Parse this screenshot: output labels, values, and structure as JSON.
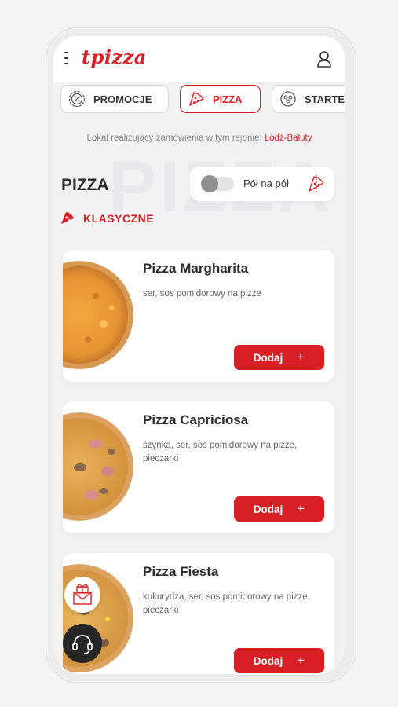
{
  "app": {
    "logo": "tpizza"
  },
  "tabs": [
    {
      "label": "PROMOCJE",
      "icon": "percent-badge-icon",
      "active": false
    },
    {
      "label": "PIZZA",
      "icon": "pizza-slice-icon",
      "active": true
    },
    {
      "label": "STARTE",
      "icon": "starter-icon",
      "active": false
    }
  ],
  "location": {
    "text": "Lokal realizujący zamówienia w tym rejonie:",
    "city": "Łódź-Bałuty"
  },
  "page": {
    "watermark": "PIZZA",
    "title": "PIZZA",
    "half_half_label": "Pół na pół",
    "half_half_enabled": false,
    "section": "KLASYCZNE"
  },
  "products": [
    {
      "name": "Pizza Margharita",
      "description": "ser, sos pomidorowy na pizze",
      "button": "Dodaj"
    },
    {
      "name": "Pizza Capriciosa",
      "description": "szynka, ser, sos pomidorowy na pizze, pieczarki",
      "button": "Dodaj"
    },
    {
      "name": "Pizza Fiesta",
      "description": "kukurydza, ser, sos pomidorowy na pizze, pieczarki",
      "button": "Dodaj"
    }
  ],
  "colors": {
    "accent": "#d81f26",
    "background": "#f2f2f3"
  }
}
